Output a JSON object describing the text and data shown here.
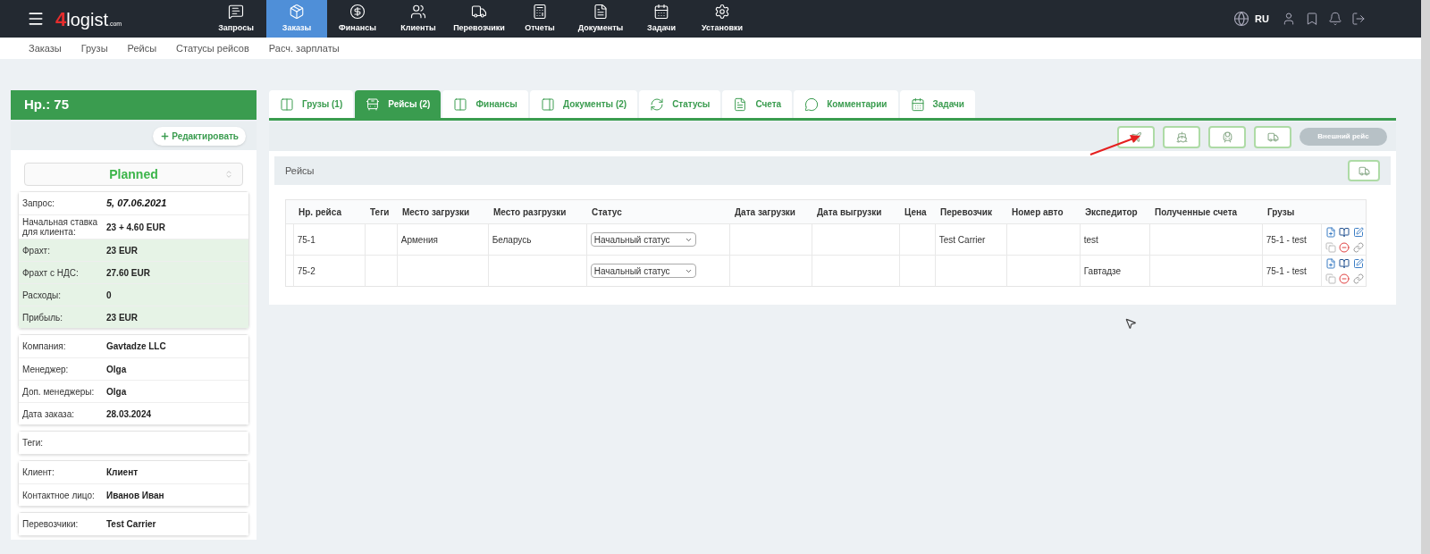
{
  "nav": {
    "logo": {
      "digit": "4",
      "word": "logist",
      "suffix": ".com"
    },
    "items": [
      {
        "label": "Запросы",
        "selected": false
      },
      {
        "label": "Заказы",
        "selected": true
      },
      {
        "label": "Финансы",
        "selected": false
      },
      {
        "label": "Клиенты",
        "selected": false
      },
      {
        "label": "Перевозчики",
        "selected": false
      },
      {
        "label": "Отчеты",
        "selected": false
      },
      {
        "label": "Документы",
        "selected": false
      },
      {
        "label": "Задачи",
        "selected": false
      },
      {
        "label": "Установки",
        "selected": false
      }
    ],
    "language": "RU"
  },
  "subnav": [
    "Заказы",
    "Грузы",
    "Рейсы",
    "Статусы рейсов",
    "Расч. зарплаты"
  ],
  "sidebar": {
    "title": "Нр.: 75",
    "edit_button": "Редактировать",
    "status": "Planned",
    "groups": [
      [
        {
          "kind": "reference",
          "label": "Запрос:",
          "value": "5, 07.06.2021",
          "highlighted": false
        },
        {
          "kind": "field",
          "label": "Начальная ставка для клиента:",
          "value": "23 + 4.60 EUR",
          "highlighted": false
        },
        {
          "kind": "field",
          "label": "Фрахт:",
          "value": "23 EUR",
          "highlighted": true
        },
        {
          "kind": "field",
          "label": "Фрахт с НДС:",
          "value": "27.60 EUR",
          "highlighted": true
        },
        {
          "kind": "field",
          "label": "Расходы:",
          "value": "0",
          "highlighted": true
        },
        {
          "kind": "field",
          "label": "Прибыль:",
          "value": "23 EUR",
          "highlighted": true
        }
      ],
      [
        {
          "kind": "field",
          "label": "Компания:",
          "value": "Gavtadze LLC",
          "highlighted": false
        },
        {
          "kind": "field",
          "label": "Менеджер:",
          "value": "Olga",
          "highlighted": false
        },
        {
          "kind": "field",
          "label": "Доп. менеджеры:",
          "value": "Olga",
          "highlighted": false
        },
        {
          "kind": "field",
          "label": "Дата заказа:",
          "value": "28.03.2024",
          "highlighted": false
        }
      ],
      [
        {
          "label": "Теги:",
          "highlighted": false
        }
      ],
      [
        {
          "kind": "field",
          "label": "Клиент:",
          "value": "Клиент",
          "highlighted": false
        },
        {
          "kind": "field",
          "label": "Контактное лицо:",
          "value": "Иванов Иван",
          "highlighted": false
        }
      ],
      [
        {
          "kind": "field",
          "label": "Перевозчики:",
          "value": "Test Carrier",
          "highlighted": false
        }
      ]
    ]
  },
  "tabs": [
    {
      "label": "Грузы (1)",
      "selected": false
    },
    {
      "label": "Рейсы (2)",
      "selected": true
    },
    {
      "label": "Финансы",
      "selected": false
    },
    {
      "label": "Документы (2)",
      "selected": false
    },
    {
      "label": "Статусы",
      "selected": false
    },
    {
      "label": "Счета",
      "selected": false
    },
    {
      "label": "Комментарии",
      "selected": false
    },
    {
      "label": "Задачи",
      "selected": false
    }
  ],
  "external_trip_button": {
    "label": "Внешний рейс",
    "disabled": true
  },
  "trips": {
    "title": "Рейсы",
    "columns": [
      "Нр. рейса",
      "Теги",
      "Место загрузки",
      "Место разгрузки",
      "Статус",
      "Дата загрузки",
      "Дата выгрузки",
      "Цена",
      "Перевозчик",
      "Номер авто",
      "Экспедитор",
      "Полученные счета",
      "Грузы"
    ],
    "rows": [
      {
        "cells": [
          "75-1",
          "",
          "Армения",
          "Беларусь",
          "Начальный статус",
          "",
          "",
          "",
          "Test Carrier",
          "",
          "test",
          "",
          "75-1 - test"
        ]
      },
      {
        "cells": [
          "75-2",
          "",
          "",
          "",
          "Начальный статус",
          "",
          "",
          "",
          "",
          "",
          "Гавтадзе",
          "",
          "75-1 - test"
        ]
      }
    ]
  }
}
